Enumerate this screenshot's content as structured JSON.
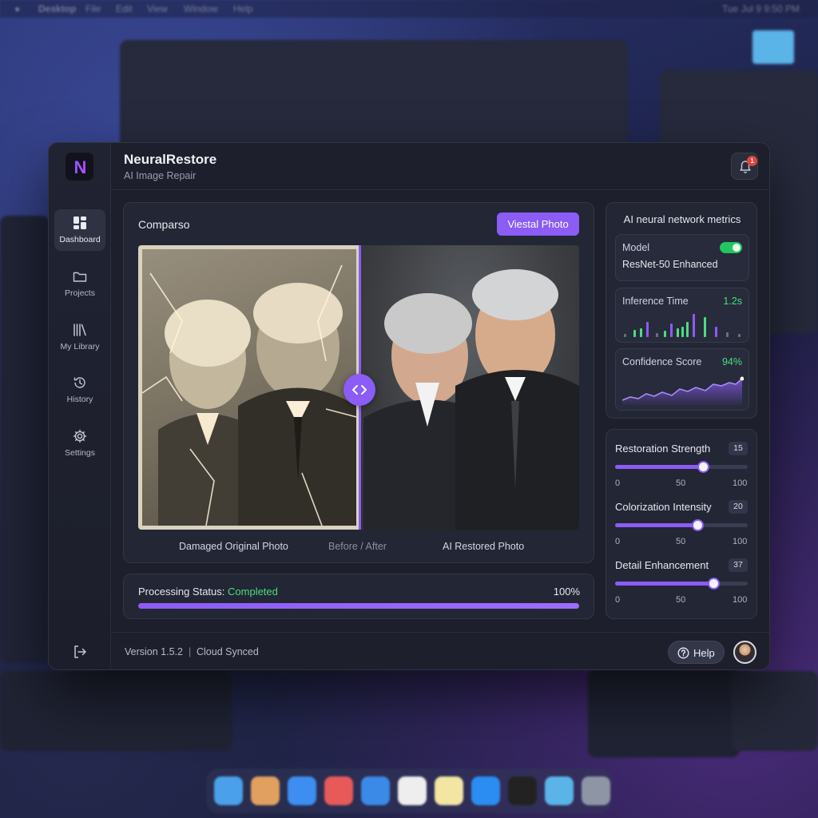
{
  "desktop": {
    "menu_items": [
      "Desktop",
      "File",
      "Edit",
      "View",
      "Window",
      "Help"
    ],
    "clock": "Tue Jul 9 9:50 PM"
  },
  "app": {
    "title": "NeuralRestore",
    "subtitle": "AI Image Repair",
    "logo_letter": "N",
    "notification_count": "1"
  },
  "sidebar": {
    "items": [
      {
        "label": "Dashboard",
        "icon": "dashboard-icon",
        "active": true
      },
      {
        "label": "Projects",
        "icon": "folder-icon"
      },
      {
        "label": "My Library",
        "icon": "library-icon"
      },
      {
        "label": "History",
        "icon": "history-icon"
      },
      {
        "label": "Settings",
        "icon": "gear-icon"
      }
    ],
    "logout_icon": "logout-icon"
  },
  "comparison": {
    "title": "Comparso",
    "action_button": "Viestal Photo",
    "before_caption": "Damaged Original Photo",
    "mid_caption": "Before / After",
    "after_caption": "AI Restored Photo",
    "handle_icon": "code-arrows-icon"
  },
  "processing": {
    "label": "Processing Status:",
    "value": "Completed",
    "percent_text": "100%",
    "progress": 1.0
  },
  "metrics": {
    "title": "AI neural network metrics",
    "model_label": "Model",
    "model_value": "ResNet-50 Enhanced",
    "model_enabled": true,
    "inference_label": "Inference Time",
    "inference_value": "1.2s",
    "confidence_label": "Confidence Score",
    "confidence_value": "94%",
    "accent_color": "#8b5cf6",
    "success_color": "#4ade80"
  },
  "sliders": [
    {
      "label": "Restoration Strength",
      "badge": "15",
      "ticks": [
        "0",
        "50",
        "100"
      ],
      "value_fraction": 0.66
    },
    {
      "label": "Colorization Intensity",
      "badge": "20",
      "ticks": [
        "0",
        "50",
        "100"
      ],
      "value_fraction": 0.62
    },
    {
      "label": "Detail Enhancement",
      "badge": "37",
      "ticks": [
        "0",
        "50",
        "100"
      ],
      "value_fraction": 0.74
    }
  ],
  "footer": {
    "version": "Version 1.5.2",
    "separator": "|",
    "sync_status": "Cloud Synced",
    "help_label": "Help"
  }
}
